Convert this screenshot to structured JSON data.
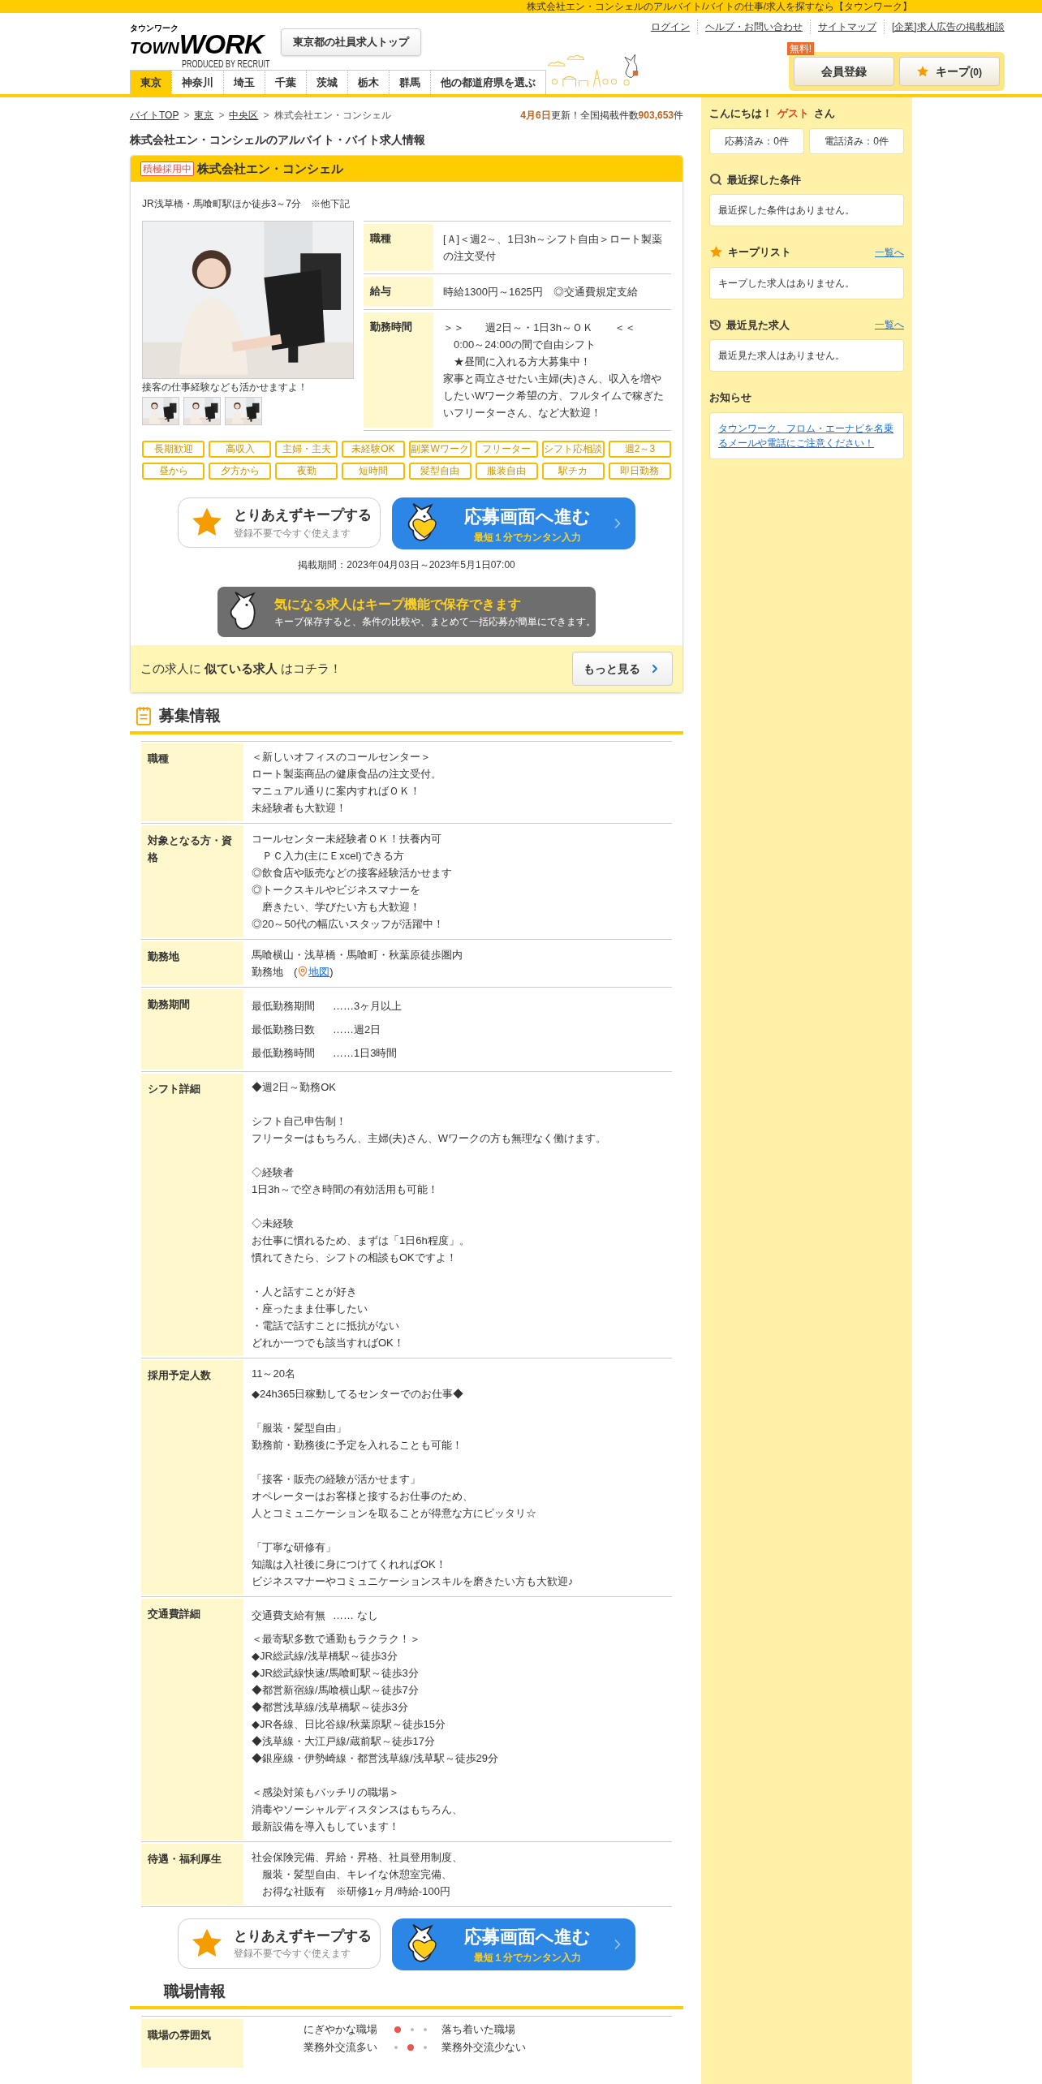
{
  "top_bar": {
    "text": "株式会社エン・コンシェルのアルバイト/バイトの仕事/求人を探すなら【タウンワーク】"
  },
  "header": {
    "logo": {
      "kana": "タウンワーク",
      "town": "TOWN",
      "work": "WORK",
      "byline": "PRODUCED BY RECRUIT"
    },
    "employer_button": "東京都の社員求人トップ",
    "links": [
      "ログイン",
      "ヘルプ・お問い合わせ",
      "サイトマップ",
      "[企業]求人広告の掲載相談"
    ],
    "member_button": {
      "label": "会員登録",
      "badge": "無料!"
    },
    "keep_button": {
      "label": "キープ",
      "count": "(0)"
    },
    "region_tabs": [
      {
        "label": "東京",
        "selected": true
      },
      {
        "label": "神奈川",
        "selected": false
      },
      {
        "label": "埼玉",
        "selected": false
      },
      {
        "label": "千葉",
        "selected": false
      },
      {
        "label": "茨城",
        "selected": false
      },
      {
        "label": "栃木",
        "selected": false
      },
      {
        "label": "群馬",
        "selected": false
      },
      {
        "label": "他の都道府県を選ぶ",
        "selected": false
      }
    ]
  },
  "breadcrumb": [
    {
      "label": "バイトTOP",
      "link": true
    },
    {
      "separator": ">",
      "label": "東京",
      "link": true
    },
    {
      "separator": ">",
      "label": "中央区",
      "link": true
    },
    {
      "separator": ">",
      "label": "株式会社エン・コンシェル",
      "link": false
    }
  ],
  "update": {
    "date": "4月6日",
    "text": "更新！全国掲載件数",
    "count": "903,653",
    "unit": "件"
  },
  "page_title": "株式会社エン・コンシェルのアルバイト・バイト求人情報",
  "job_card": {
    "badge": "積極採用中",
    "company": "株式会社エン・コンシェル",
    "access": "JR浅草橋・馬喰町駅ほか徒歩3～7分　※他下記",
    "photo_caption": "接客の仕事経験なども活かせますよ！",
    "summary": [
      {
        "label": "職種",
        "lines": [
          "[Ａ]＜週2～、1日3h～シフト自由＞ロート製薬の注文受付"
        ]
      },
      {
        "label": "給与",
        "lines": [
          "時給1300円～1625円　◎交通費規定支給"
        ]
      },
      {
        "label": "勤務時間",
        "lines": [
          "＞＞　　週2日～・1日3h～ＯＫ　　＜＜",
          "　0:00～24:00の間で自由シフト",
          "　★昼間に入れる方大募集中！",
          "家事と両立させたい主婦(夫)さん、収入を増やしたいWワーク希望の方、フルタイムで稼ぎたいフリーターさん、など大歓迎！"
        ]
      }
    ],
    "tags": [
      "長期歓迎",
      "高収入",
      "主婦・主夫",
      "未経験OK",
      "副業Wワーク",
      "フリーター",
      "シフト応相談",
      "週2～3",
      "昼から",
      "夕方から",
      "夜勤",
      "短時間",
      "髪型自由",
      "服装自由",
      "駅チカ",
      "即日勤務"
    ],
    "keep_action": {
      "title": "とりあえずキープする",
      "subtitle": "登録不要で今すぐ使えます"
    },
    "apply_action": {
      "title": "応募画面へ進む",
      "subtitle": "最短１分でカンタン入力"
    },
    "posting_period": "掲載期間：2023年04月03日～2023年5月1日07:00",
    "keep_banner": {
      "title": "気になる求人はキープ機能で保存できます",
      "text": "キープ保存すると、条件の比較や、まとめて一括応募が簡単にできます。"
    },
    "similar": {
      "text": "この求人に **似ている求人** はコチラ！",
      "button": "もっと見る"
    }
  },
  "recruitment": {
    "heading": "募集情報",
    "rows": [
      {
        "label": "職種",
        "blocks": [
          {
            "kind": "paragraph",
            "lines": [
              "＜新しいオフィスのコールセンター＞",
              "ロート製薬商品の健康食品の注文受付。",
              "マニュアル通りに案内すればＯＫ！",
              "未経験者も大歓迎！"
            ]
          }
        ]
      },
      {
        "label": "対象となる方・資格",
        "blocks": [
          {
            "kind": "paragraph",
            "lines": [
              "コールセンター未経験者ＯＫ！扶養内可",
              "　ＰＣ入力(主にＥxcel)できる方",
              "◎飲食店や販売などの接客経験活かせます",
              "◎トークスキルやビジネスマナーを",
              "　磨きたい、学びたい方も大歓迎！",
              "◎20～50代の幅広いスタッフが活躍中！"
            ]
          }
        ]
      },
      {
        "label": "勤務地",
        "blocks": [
          {
            "kind": "paragraph",
            "lines": [
              "馬喰横山・浅草橋・馬喰町・秋葉原徒歩圏内"
            ]
          },
          {
            "kind": "map",
            "prefix": "勤務地　(",
            "link": "地図",
            "suffix": ")"
          }
        ]
      },
      {
        "label": "勤務期間",
        "blocks": [
          {
            "kind": "pair",
            "label": "最低勤務期間",
            "value": "……3ヶ月以上"
          },
          {
            "kind": "pair",
            "label": "最低勤務日数",
            "value": "……週2日"
          },
          {
            "kind": "pair",
            "label": "最低勤務時間",
            "value": "……1日3時間"
          }
        ]
      },
      {
        "label": "シフト詳細",
        "blocks": [
          {
            "kind": "paragraph",
            "lines": [
              "◆週2日～勤務OK"
            ]
          },
          {
            "kind": "paragraph",
            "lines": [
              "シフト自己申告制！",
              "フリーターはもちろん、主婦(夫)さん、Wワークの方も無理なく働けます。"
            ]
          },
          {
            "kind": "paragraph",
            "lines": [
              "◇経験者",
              "1日3h～で空き時間の有効活用も可能！"
            ]
          },
          {
            "kind": "paragraph",
            "lines": [
              "◇未経験",
              "お仕事に慣れるため、まずは「1日6h程度」。",
              "慣れてきたら、シフトの相談もOKですよ！"
            ]
          },
          {
            "kind": "paragraph",
            "lines": [
              "・人と話すことが好き",
              "・座ったまま仕事したい",
              "・電話で話すことに抵抗がない",
              "どれか一つでも該当すればOK！"
            ]
          }
        ]
      },
      {
        "label": "採用予定人数",
        "blocks": [
          {
            "kind": "paragraph",
            "lines": [
              "11～20名"
            ]
          },
          {
            "kind": "tight",
            "lines": [
              "◆24h365日稼動してるセンターでのお仕事◆"
            ]
          },
          {
            "kind": "paragraph",
            "lines": [
              "「服装・髪型自由」",
              "勤務前・勤務後に予定を入れることも可能！"
            ]
          },
          {
            "kind": "paragraph",
            "lines": [
              "「接客・販売の経験が活かせます」",
              "オペレーターはお客様と接するお仕事のため、",
              "人とコミュニケーションを取ることが得意な方にピッタリ☆"
            ]
          },
          {
            "kind": "paragraph",
            "lines": [
              "「丁寧な研修有」",
              "知識は入社後に身につけてくれればOK！",
              "ビジネスマナーやコミュニケーションスキルを磨きたい方も大歓迎♪"
            ]
          }
        ]
      },
      {
        "label": "交通費詳細",
        "blocks": [
          {
            "kind": "pair",
            "label": "交通費支給有無",
            "value": "…… なし"
          },
          {
            "kind": "tight",
            "lines": [
              "＜最寄駅多数で通勤もラクラク！＞",
              "◆JR総武線/浅草橋駅～徒歩3分",
              "◆JR総武線快速/馬喰町駅～徒歩3分",
              "◆都営新宿線/馬喰横山駅～徒歩7分",
              "◆都営浅草線/浅草橋駅～徒歩3分",
              "◆JR各線、日比谷線/秋葉原駅～徒歩15分",
              "◆浅草線・大江戸線/蔵前駅～徒歩17分",
              "◆銀座線・伊勢崎線・都営浅草線/浅草駅～徒歩29分"
            ]
          },
          {
            "kind": "paragraph",
            "lines": [
              "＜感染対策もバッチリの職場＞",
              "消毒やソーシャルディスタンスはもちろん、",
              "最新設備を導入もしています！"
            ]
          }
        ]
      },
      {
        "label": "待遇・福利厚生",
        "blocks": [
          {
            "kind": "paragraph",
            "lines": [
              "社会保険完備、昇給・昇格、社員登用制度、",
              "　服装・髪型自由、キレイな休憩室完備、",
              "　お得な社販有　※研修1ヶ月/時給-100円"
            ]
          }
        ]
      }
    ]
  },
  "bottom_actions": {
    "keep_title": "とりあえずキープする",
    "keep_subtitle": "登録不要で今すぐ使えます",
    "apply_title": "応募画面へ進む",
    "apply_subtitle": "最短１分でカンタン入力"
  },
  "workplace": {
    "heading": "職場情報",
    "rows": [
      {
        "label": "職場の雰囲気",
        "scales": [
          {
            "left": "にぎやかな職場",
            "right": "落ち着いた職場",
            "dots": [
              {
                "selected": true
              },
              {
                "selected": false
              },
              {
                "selected": false
              }
            ]
          },
          {
            "left": "業務外交流多い",
            "right": "業務外交流少ない",
            "dots": [
              {
                "selected": false
              },
              {
                "selected": true
              },
              {
                "selected": false
              }
            ]
          }
        ]
      }
    ]
  },
  "sidebar": {
    "greeting": "こんにちは！",
    "user": "ゲスト",
    "honorific": "さん",
    "counters": [
      "応募済み：0件",
      "電話済み：0件"
    ],
    "sections": [
      {
        "kind": "search",
        "title": "最近探した条件",
        "message": "最近探した条件はありません。"
      },
      {
        "kind": "keep",
        "title": "キープリスト",
        "link": "一覧へ",
        "message": "キープした求人はありません。"
      },
      {
        "kind": "history",
        "title": "最近見た求人",
        "link": "一覧へ",
        "message": "最近見た求人はありません。"
      },
      {
        "kind": "notice",
        "title": "お知らせ",
        "notice_link": "タウンワーク、フロム・エーナビを名乗るメールや電話にご注意ください！"
      }
    ]
  }
}
